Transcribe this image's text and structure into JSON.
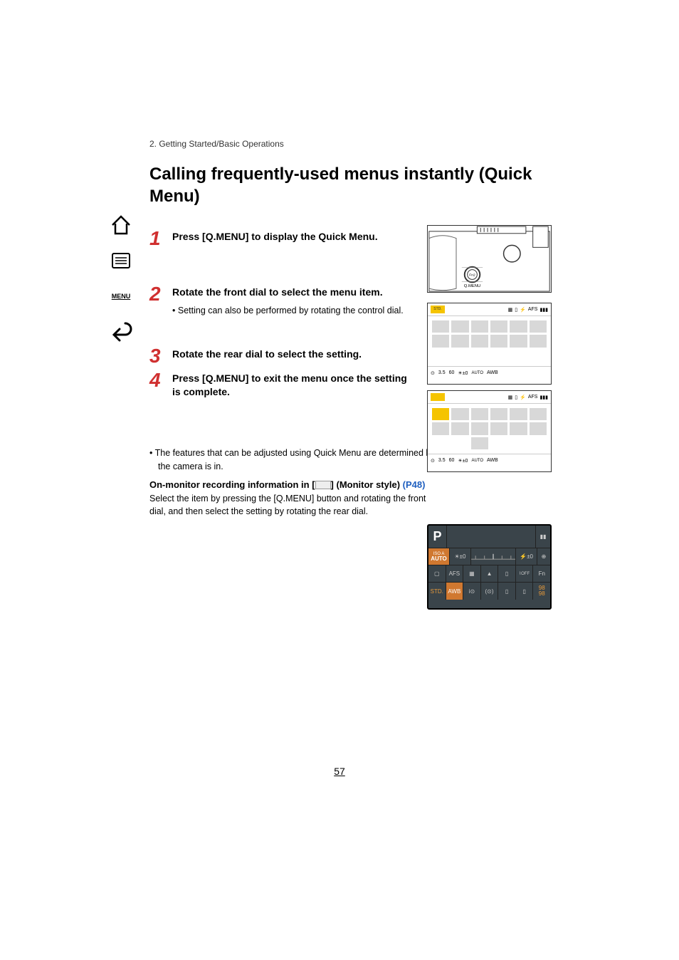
{
  "breadcrumb": "2. Getting Started/Basic Operations",
  "page_title": "Calling frequently-used menus instantly (Quick Menu)",
  "steps": {
    "s1": {
      "num": "1",
      "title": "Press [Q.MENU] to display the Quick Menu."
    },
    "s2": {
      "num": "2",
      "title": "Rotate the front dial to select the menu item.",
      "sub": "Setting can also be performed by rotating the control dial."
    },
    "s3": {
      "num": "3",
      "title": "Rotate the rear dial to select the setting."
    },
    "s4": {
      "num": "4",
      "title": "Press [Q.MENU] to exit the menu once the setting is complete."
    }
  },
  "notes": {
    "bullet": "The features that can be adjusted using Quick Menu are determined by the mode or a display style the camera is in.",
    "subhead_pre": "On-monitor recording information in [",
    "subhead_post": "] (Monitor style) ",
    "subhead_link": "(P48)",
    "body": "Select the item by pressing the [Q.MENU] button and rotating the front dial, and then select the setting by rotating the rear dial."
  },
  "page_number": "57",
  "sidebar": {
    "home": "home-icon",
    "toc": "toc-icon",
    "menu": "MENU",
    "back": "back-icon"
  },
  "camera_illo": {
    "fn2": "Fn2",
    "qmenu": "Q.MENU"
  },
  "screen1": {
    "std": "STD.",
    "afs": "AFS",
    "bottom_f": "3.5",
    "bottom_s": "60",
    "bottom_ev": "±0",
    "bottom_auto": "AUTO",
    "bottom_awb": "AWB"
  },
  "screen2": {
    "afs": "AFS",
    "bottom_f": "3.5",
    "bottom_s": "60",
    "bottom_ev": "±0",
    "bottom_auto": "AUTO",
    "bottom_awb": "AWB"
  },
  "monitor": {
    "mode": "P",
    "iso": "ISO A",
    "auto": "AUTO",
    "ev": "±0",
    "ev2": "±0",
    "afs": "AFS",
    "off": "OFF",
    "fn": "Fn",
    "std": "STD.",
    "awb": "AWB",
    "count": "98",
    "count2": "98"
  }
}
